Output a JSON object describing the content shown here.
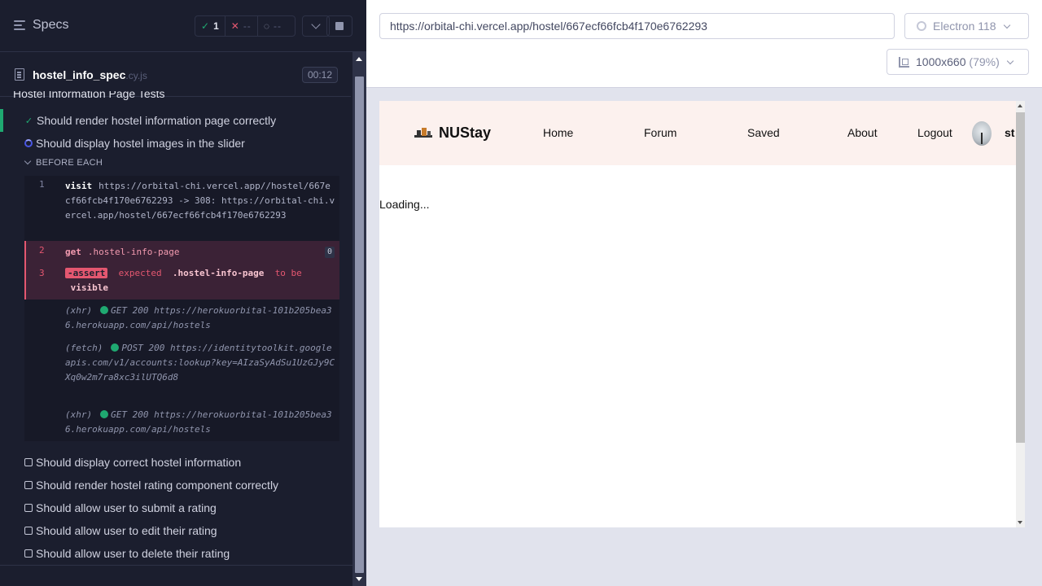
{
  "reporter": {
    "header": {
      "title": "Specs",
      "stats": {
        "passed": "1",
        "failed": "--",
        "pending": "--"
      }
    },
    "spec_file": {
      "name": "hostel_info_spec",
      "ext": ".cy.js",
      "duration": "00:12"
    },
    "suite_title": "Hostel Information Page Tests",
    "tests": [
      {
        "label": "Should render hostel information page correctly",
        "state": "passed"
      },
      {
        "label": "Should display hostel images in the slider",
        "state": "running"
      }
    ],
    "hook_label": "BEFORE EACH",
    "commands": [
      {
        "num": "1",
        "name": "visit",
        "arg": "https://orbital-chi.vercel.app//hostel/667ecf66fcb4f170e6762293 -> 308: https://orbital-chi.vercel.app/hostel/667ecf66fcb4f170e6762293"
      },
      {
        "num": "2",
        "name": "get",
        "arg": ".hostel-info-page",
        "badge": "0"
      },
      {
        "num": "3",
        "name": "-assert",
        "expected": "expected",
        "selector": ".hostel-info-page",
        "tobe": "to be",
        "visible": "visible"
      }
    ],
    "requests": [
      {
        "type": "(xhr)",
        "method": "GET 200",
        "url": "https://herokuorbital-101b205bea36.herokuapp.com/api/hostels"
      },
      {
        "type": "(fetch)",
        "method": "POST 200",
        "url": "https://identitytoolkit.googleapis.com/v1/accounts:lookup?key=AIzaSyAdSu1UzGJy9CXq0w2m7ra8xc3ilUTQ6d8"
      },
      {
        "type": "(xhr)",
        "method": "GET 200",
        "url": "https://herokuorbital-101b205bea36.herokuapp.com/api/hostels"
      }
    ],
    "remaining_tests": [
      "Should display correct hostel information",
      "Should render hostel rating component correctly",
      "Should allow user to submit a rating",
      "Should allow user to edit their rating",
      "Should allow user to delete their rating"
    ]
  },
  "browser": {
    "url": "https://orbital-chi.vercel.app/hostel/667ecf66fcb4f170e6762293",
    "browser_name": "Electron 118",
    "viewport": "1000x660",
    "zoom": "(79%)"
  },
  "app": {
    "brand": "NUStay",
    "nav": [
      "Home",
      "Forum",
      "Saved",
      "About",
      "Logout"
    ],
    "user_partial": "st",
    "loading_text": "Loading..."
  },
  "icons": {
    "menu": "hamburger-icon",
    "passed": "check-icon",
    "failed": "x-icon",
    "pending": "spinner-icon",
    "browser": "electron-icon",
    "viewport": "ruler-icon"
  },
  "colors": {
    "reporter_bg": "#1b1e2e",
    "pass": "#1fa971",
    "fail": "#e45770",
    "running": "#4956e3",
    "nav_bg": "#fcf1ee"
  }
}
